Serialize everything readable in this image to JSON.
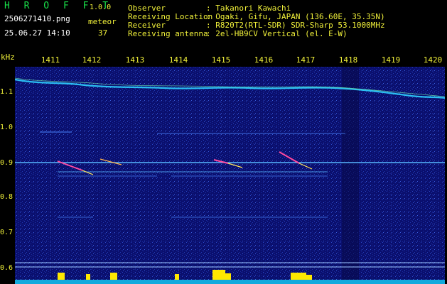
{
  "header": {
    "app_title": "H R O F F T",
    "version": "1.0.0",
    "filename": "2506271410.png",
    "meteor_label": "meteor",
    "datetime": "25.06.27 14:10",
    "meteor_count": "37",
    "info": [
      {
        "label": "Observer",
        "value": ": Takanori Kawachi"
      },
      {
        "label": "Receiving Location",
        "value": ": Ogaki, Gifu, JAPAN (136.60E, 35.35N)"
      },
      {
        "label": "Receiver",
        "value": ": R820T2(RTL-SDR) SDR-Sharp 53.1000MHz"
      },
      {
        "label": "Receiving antenna",
        "value": ": 2el-HB9CV Vertical (el. E-W)"
      }
    ]
  },
  "axis": {
    "unit": "kHz",
    "x_ticks": [
      "1411",
      "1412",
      "1413",
      "1414",
      "1415",
      "1416",
      "1417",
      "1418",
      "1419",
      "1420"
    ],
    "y_ticks": [
      "1.1",
      "1.0",
      "0.9",
      "0.8",
      "0.7",
      "0.6"
    ]
  },
  "colors": {
    "background": "#0a0f6e",
    "trace": "#2fd0ff",
    "meteor": "#ff4aa0",
    "amplitude": "#ffe800",
    "axis_text": "#f2f23a"
  }
}
